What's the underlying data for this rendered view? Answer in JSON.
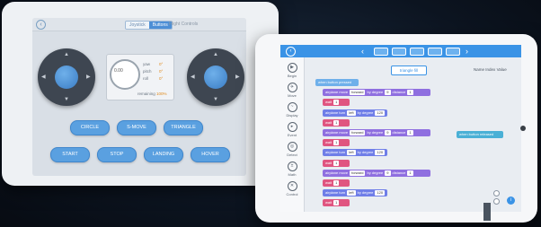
{
  "left_app": {
    "segmented": [
      "Joystick",
      "Buttons"
    ],
    "active_segment": 1,
    "title": "Flight Controls",
    "gauge": {
      "dial_value": "0.00",
      "rows": [
        {
          "label": "yaw",
          "value": "0°"
        },
        {
          "label": "pitch",
          "value": "0°"
        },
        {
          "label": "roll",
          "value": "0°"
        }
      ],
      "battery_label": "remaining",
      "battery_value": "100%"
    },
    "row1_buttons": [
      "CIRCLE",
      "S-MOVE",
      "TRIANGLE"
    ],
    "row2_buttons": [
      "START",
      "STOP",
      "LANDING",
      "HOVER"
    ]
  },
  "right_app": {
    "program_name": "triangle fill",
    "var_columns": [
      "Name",
      "Index",
      "Value"
    ],
    "sidebar": [
      "Begin",
      "Move",
      "Display",
      "Event",
      "Detect",
      "Math",
      "Control"
    ],
    "blocks": [
      {
        "text": "when button pressed",
        "kind": "h"
      },
      {
        "text": "airplane move",
        "arg": "forward",
        "extra": "by degree",
        "val": "9",
        "extra2": "distance",
        "val2": "1",
        "kind": "p"
      },
      {
        "text": "wait",
        "arg": "1",
        "kind": "r"
      },
      {
        "text": "airplane turn",
        "arg": "left",
        "extra": "by degree",
        "val": "120",
        "kind": "v"
      },
      {
        "text": "wait",
        "arg": "1",
        "kind": "r"
      },
      {
        "text": "airplane move",
        "arg": "forward",
        "extra": "by degree",
        "val": "9",
        "extra2": "distance",
        "val2": "1",
        "kind": "p"
      },
      {
        "text": "wait",
        "arg": "1",
        "kind": "r"
      },
      {
        "text": "airplane turn",
        "arg": "left",
        "extra": "by degree",
        "val": "120",
        "kind": "v"
      },
      {
        "text": "wait",
        "arg": "1",
        "kind": "r"
      },
      {
        "text": "airplane move",
        "arg": "forward",
        "extra": "by degree",
        "val": "9",
        "extra2": "distance",
        "val2": "1",
        "kind": "p"
      },
      {
        "text": "wait",
        "arg": "1",
        "kind": "r"
      },
      {
        "text": "airplane turn",
        "arg": "left",
        "extra": "by degree",
        "val": "120",
        "kind": "v"
      },
      {
        "text": "wait",
        "arg": "1",
        "kind": "r"
      }
    ],
    "side_event": "when button released"
  }
}
